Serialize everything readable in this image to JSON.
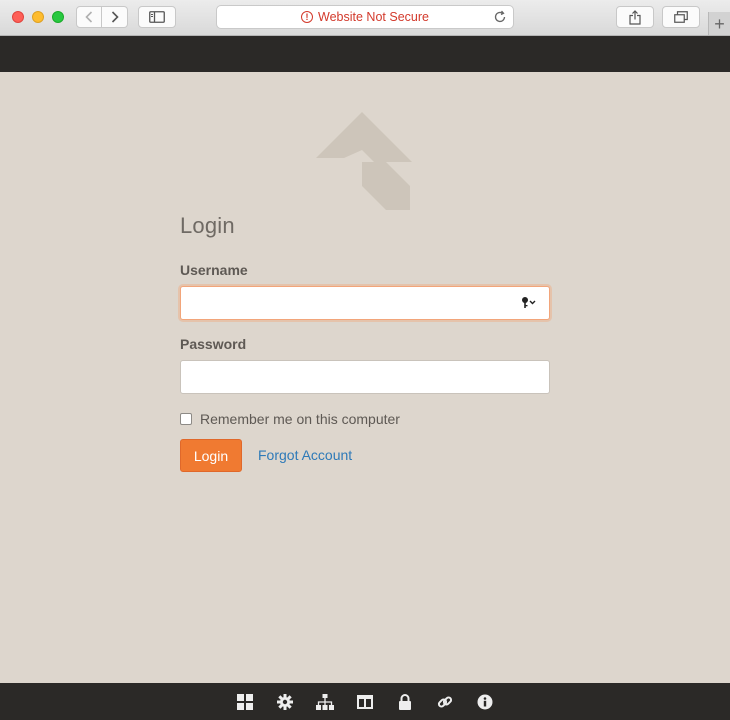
{
  "browser": {
    "address_text": "Website Not Secure",
    "warning_color": "#d33a2c",
    "new_tab_label": "+"
  },
  "brand": {
    "logo_icon": "brand-logo-icon",
    "accent": "#f07a31",
    "link_color": "#2e7ab8"
  },
  "form": {
    "title": "Login",
    "username_label": "Username",
    "username_value": "",
    "password_label": "Password",
    "password_value": "",
    "remember_label": "Remember me on this computer",
    "remember_checked": false,
    "login_button": "Login",
    "forgot_link": "Forgot Account"
  },
  "footer": {
    "icons": [
      "dashboard-icon",
      "gear-icon",
      "sitemap-icon",
      "columns-icon",
      "lock-icon",
      "link-icon",
      "info-icon"
    ]
  }
}
